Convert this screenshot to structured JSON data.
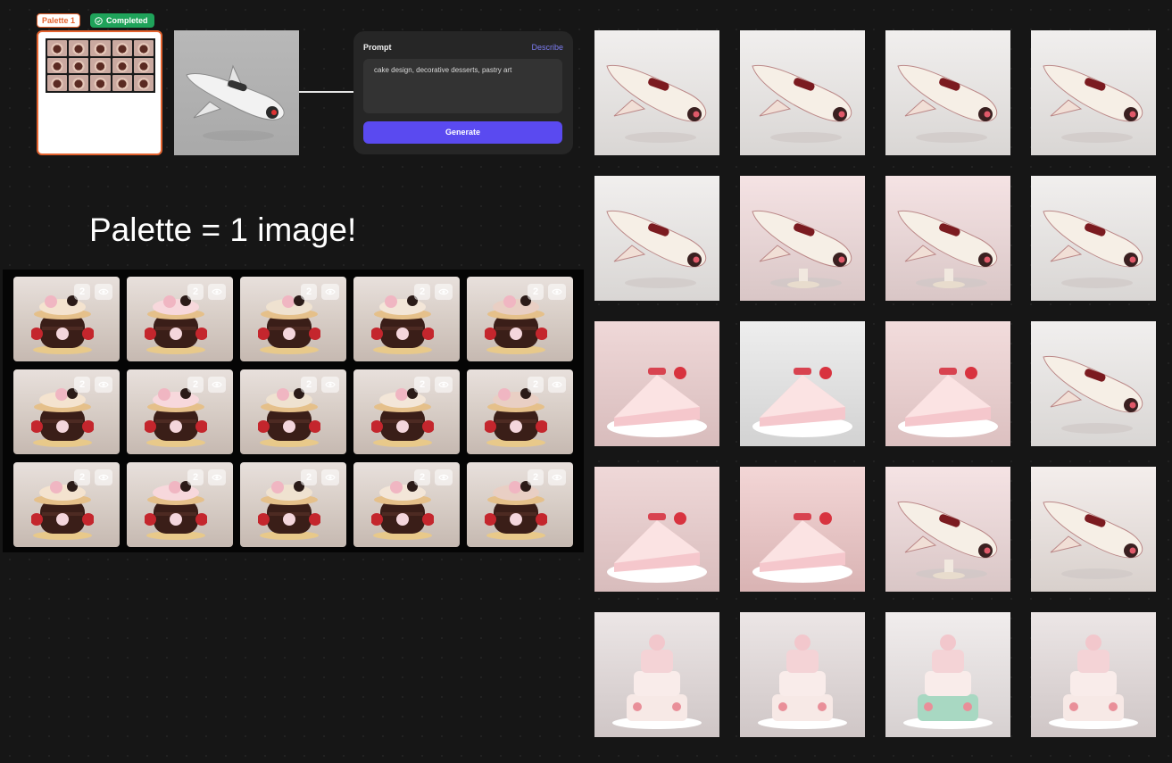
{
  "palette_node": {
    "tag_label": "Palette 1",
    "status_label": "Completed",
    "thumb_count": 15
  },
  "prompt_panel": {
    "title": "Prompt",
    "describe_label": "Describe",
    "prompt_text": "cake design, decorative desserts, pastry art",
    "generate_label": "Generate"
  },
  "heading": "Palette = 1 image!",
  "palette_sheet": {
    "badge": "2",
    "rows": 3,
    "cols": 5
  },
  "results": {
    "rows": [
      [
        "spaceship-cake",
        "spaceship-cake",
        "spaceship-cake",
        "spaceship-cake"
      ],
      [
        "spaceship-cake",
        "spaceship-cake-on-stand",
        "spaceship-cake-on-stand",
        "spaceship-cake"
      ],
      [
        "spaceship-slice-cake",
        "pink-cake-slice",
        "cake-slice-on-stand",
        "spaceship-cake"
      ],
      [
        "spaceship-slice-cake",
        "pink-cake",
        "spaceship-cake-on-stand",
        "pink-spaceship-cake"
      ],
      [
        "tiered-cake",
        "tiered-cake",
        "tiered-cake-mint",
        "tiered-cake"
      ]
    ]
  },
  "colors": {
    "accent_orange": "#e4632f",
    "status_green": "#1fa35a",
    "generate_purple": "#5a4af0",
    "describe_link": "#7c7cf0",
    "canvas": "#161616"
  }
}
